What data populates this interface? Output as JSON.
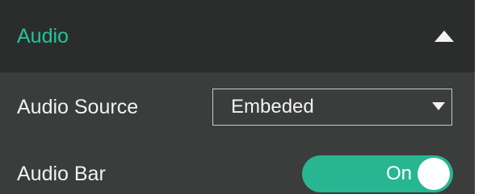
{
  "section": {
    "title": "Audio",
    "collapse_icon": "triangle-up-icon"
  },
  "audio_source": {
    "label": "Audio Source",
    "selected_value": "Embeded",
    "dropdown_icon": "triangle-down-icon"
  },
  "audio_bar": {
    "label": "Audio Bar",
    "state_label": "On",
    "state": true
  },
  "colors": {
    "accent": "#27c39a",
    "toggle_on": "#27b592",
    "header_background": "#2b2d2d",
    "panel_background": "#3a3d3c",
    "text": "#f2f2f2"
  }
}
